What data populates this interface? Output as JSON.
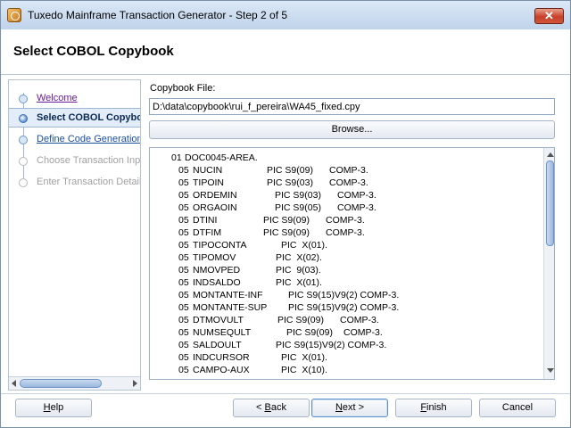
{
  "window": {
    "title": "Tuxedo Mainframe Transaction Generator - Step 2 of 5",
    "close_label": "✕"
  },
  "page": {
    "title": "Select COBOL Copybook"
  },
  "steps": [
    {
      "label": "Welcome",
      "state": "done"
    },
    {
      "label": "Select COBOL Copybook",
      "state": "current"
    },
    {
      "label": "Define Code Generation",
      "state": "link"
    },
    {
      "label": "Choose Transaction Input",
      "state": "disabled"
    },
    {
      "label": "Enter Transaction Details",
      "state": "disabled"
    }
  ],
  "copybook": {
    "label": "Copybook File:",
    "value": "D:\\data\\copybook\\rui_f_pereira\\WA45_fixed.cpy",
    "browse_label": "Browse..."
  },
  "listing": [
    {
      "level": "01",
      "name": "DOC0045-AREA.",
      "pic": "",
      "usage": ""
    },
    {
      "level": "05",
      "name": "NUCIN",
      "pic": "PIC S9(09)",
      "usage": "COMP-3."
    },
    {
      "level": "05",
      "name": "TIPOIN",
      "pic": "PIC S9(03)",
      "usage": "COMP-3."
    },
    {
      "level": "05",
      "name": "ORDEMIN",
      "pic": "PIC S9(03)",
      "usage": "COMP-3."
    },
    {
      "level": "05",
      "name": "ORGAOIN",
      "pic": "PIC S9(05)",
      "usage": "COMP-3."
    },
    {
      "level": "05",
      "name": "DTINI",
      "pic": "PIC S9(09)",
      "usage": "COMP-3."
    },
    {
      "level": "05",
      "name": "DTFIM",
      "pic": "PIC S9(09)",
      "usage": "COMP-3."
    },
    {
      "level": "05",
      "name": "TIPOCONTA",
      "pic": "PIC  X(01).",
      "usage": ""
    },
    {
      "level": "05",
      "name": "TIPOMOV",
      "pic": "PIC  X(02).",
      "usage": ""
    },
    {
      "level": "05",
      "name": "NMOVPED",
      "pic": "PIC  9(03).",
      "usage": ""
    },
    {
      "level": "05",
      "name": "INDSALDO",
      "pic": "PIC  X(01).",
      "usage": ""
    },
    {
      "level": "05",
      "name": "MONTANTE-INF",
      "pic": "PIC S9(15)V9(2) COMP-3.",
      "usage": ""
    },
    {
      "level": "05",
      "name": "MONTANTE-SUP",
      "pic": "PIC S9(15)V9(2) COMP-3.",
      "usage": ""
    },
    {
      "level": "05",
      "name": "DTMOVULT",
      "pic": "PIC S9(09)",
      "usage": "COMP-3."
    },
    {
      "level": "05",
      "name": "NUMSEQULT",
      "pic": "PIC S9(09)",
      "usage": "COMP-3."
    },
    {
      "level": "05",
      "name": "SALDOULT",
      "pic": "PIC S9(15)V9(2) COMP-3.",
      "usage": ""
    },
    {
      "level": "05",
      "name": "INDCURSOR",
      "pic": "PIC  X(01).",
      "usage": ""
    },
    {
      "level": "05",
      "name": "CAMPO-AUX",
      "pic": "PIC  X(10).",
      "usage": ""
    }
  ],
  "buttons": {
    "help": "Help",
    "back": "< Back",
    "next": "Next >",
    "finish": "Finish",
    "cancel": "Cancel"
  }
}
